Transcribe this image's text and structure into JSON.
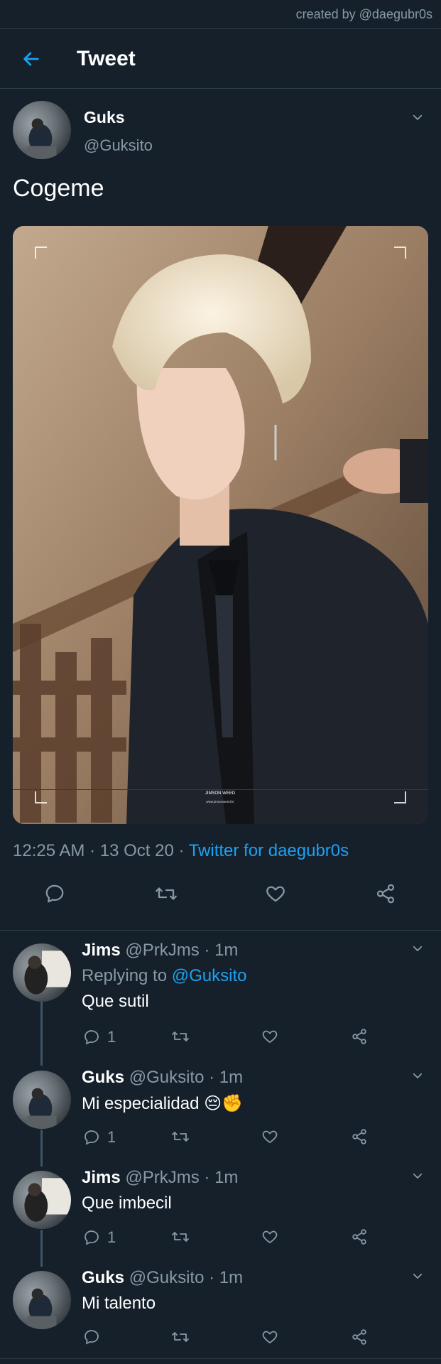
{
  "credit": "created by @daegubr0s",
  "header": {
    "title": "Tweet",
    "back_icon": "arrow-left-icon"
  },
  "main_tweet": {
    "name": "Guks",
    "handle": "@Guksito",
    "text": "Cogeme",
    "media_watermark_line1": "JIMSON WEED",
    "media_watermark_line2": "www.jimsonweed.kr",
    "time": "12:25 AM",
    "date": "13 Oct 20",
    "separator": " · ",
    "source": "Twitter for daegubr0s",
    "actions": [
      "reply-icon",
      "retweet-icon",
      "like-icon",
      "share-icon"
    ]
  },
  "replies": [
    {
      "name": "Jims",
      "handle": "@PrkJms",
      "time": "· 1m",
      "replying_label": "Replying to",
      "replying_to": "@Guksito",
      "text": "Que sutil",
      "reply_count": "1"
    },
    {
      "name": "Guks",
      "handle": "@Guksito",
      "time": "· 1m",
      "text": "Mi especialidad 😔✊",
      "reply_count": "1"
    },
    {
      "name": "Jims",
      "handle": "@PrkJms",
      "time": "· 1m",
      "text": "Que imbecil",
      "reply_count": "1"
    },
    {
      "name": "Guks",
      "handle": "@Guksito",
      "time": "· 1m",
      "text": "Mi talento",
      "reply_count": ""
    }
  ],
  "colors": {
    "background": "#15202b",
    "accent": "#1da1f2",
    "secondary_text": "#8899a6",
    "divider": "#2f3d4a"
  }
}
